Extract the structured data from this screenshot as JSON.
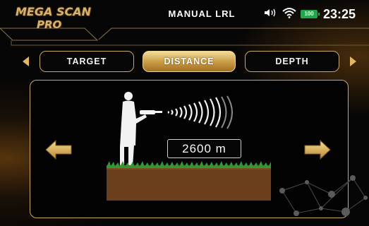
{
  "header": {
    "logo_line1": "MEGA SCAN",
    "logo_line2": "PRO",
    "title": "MANUAL LRL",
    "battery": "100",
    "time": "23:25"
  },
  "tabs": [
    {
      "label": "TARGET",
      "active": false
    },
    {
      "label": "DISTANCE",
      "active": true
    },
    {
      "label": "DEPTH",
      "active": false
    }
  ],
  "main": {
    "distance_value": "2600 m"
  },
  "icons": {
    "speaker": "speaker-icon",
    "wifi": "wifi-icon",
    "battery": "battery-icon",
    "prev_tab": "chevron-left-icon",
    "next_tab": "chevron-right-icon",
    "decrease": "arrow-left-icon",
    "increase": "arrow-right-icon"
  },
  "colors": {
    "accent_gold": "#c7a864",
    "battery_green": "#1fa84a"
  }
}
